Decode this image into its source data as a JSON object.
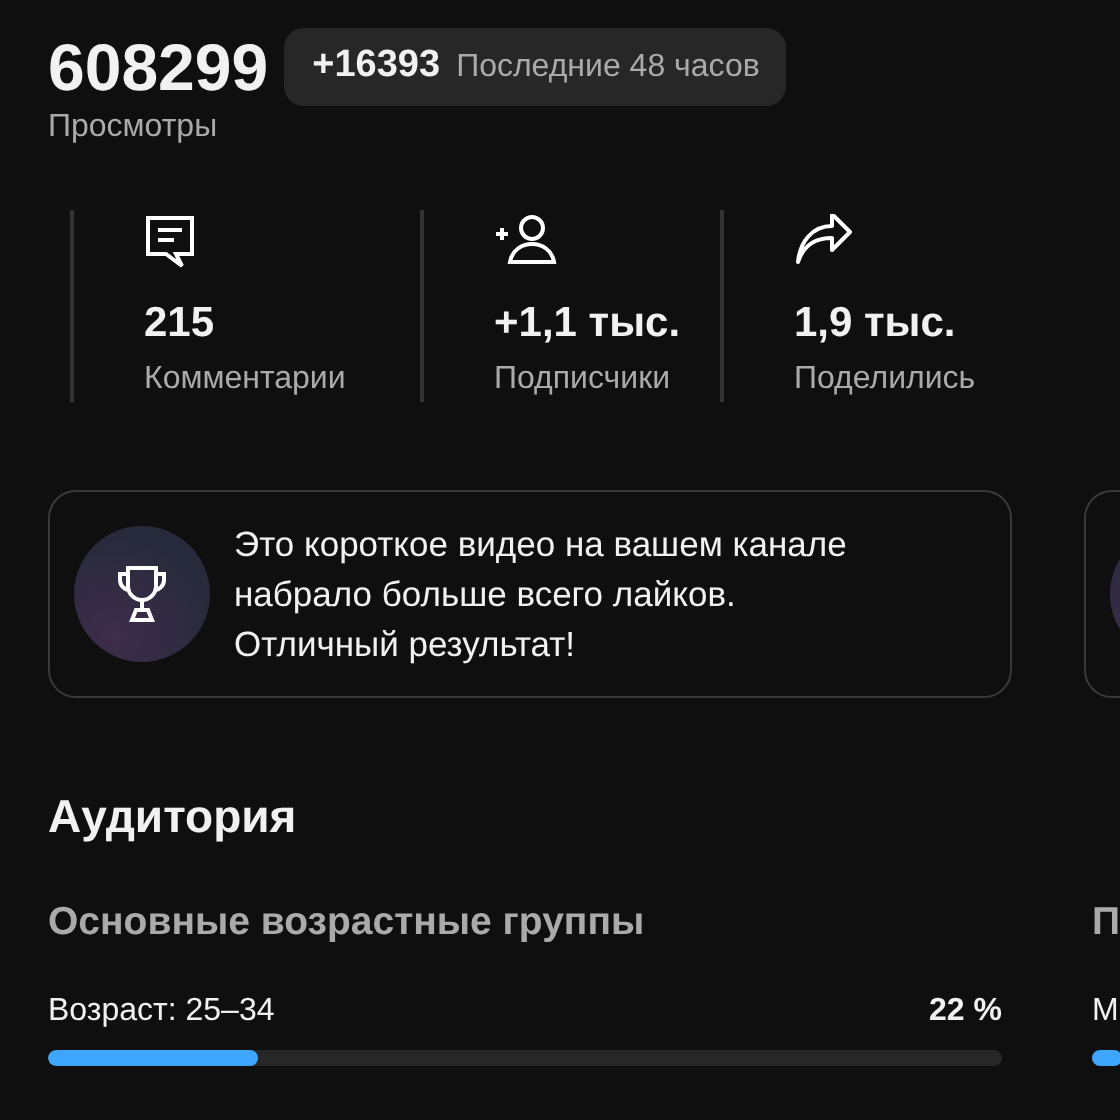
{
  "views": {
    "total": "608299",
    "delta": "+16393",
    "period": "Последние 48 часов",
    "label": "Просмотры"
  },
  "stats": [
    {
      "kind": "comments",
      "value": "215",
      "label": "Комментарии"
    },
    {
      "kind": "subscribers",
      "value": "+1,1 тыс.",
      "label": "Подписчики"
    },
    {
      "kind": "shares",
      "value": "1,9 тыс.",
      "label": "Поделились"
    }
  ],
  "cards": [
    {
      "kind": "trophy",
      "text": "Это короткое видео на вашем канале набрало больше всего лайков. Отличный результат!"
    },
    {
      "kind": "partial"
    }
  ],
  "audience": {
    "title": "Аудитория",
    "groups": [
      {
        "title": "Основные возрастные группы",
        "rows": [
          {
            "label": "Возраст: 25–34",
            "value": "22 %",
            "level": 0.22
          }
        ]
      },
      {
        "title": "П",
        "rows": [
          {
            "label": "М"
          }
        ]
      }
    ]
  }
}
